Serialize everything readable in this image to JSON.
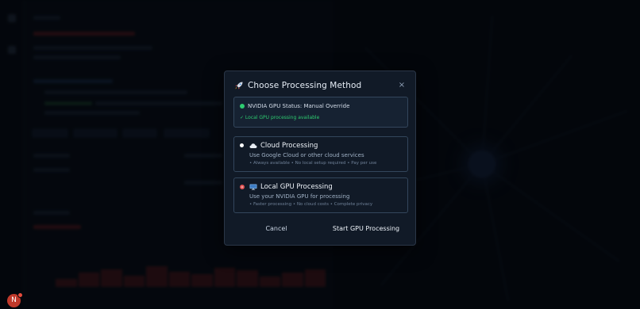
{
  "modal": {
    "title": "Choose Processing Method",
    "close_label": "×",
    "status": {
      "label": "NVIDIA GPU Status: Manual Override",
      "availability": "✓ Local GPU processing available",
      "indicator_color": "#2ecc71"
    },
    "options": [
      {
        "title": "Cloud Processing",
        "icon": "cloud-icon",
        "description": "Use Google Cloud or other cloud services",
        "features": "• Always available • No local setup required • Pay per use",
        "selected": false
      },
      {
        "title": "Local GPU Processing",
        "icon": "monitor-icon",
        "description": "Use your NVIDIA GPU for processing",
        "features": "• Faster processing • No cloud costs • Complete privacy",
        "selected": true
      }
    ],
    "cancel_label": "Cancel",
    "start_label": "Start GPU Processing"
  },
  "fab": {
    "label": "N"
  },
  "colors": {
    "accent_red": "#e05050",
    "success_green": "#2ecc71"
  }
}
